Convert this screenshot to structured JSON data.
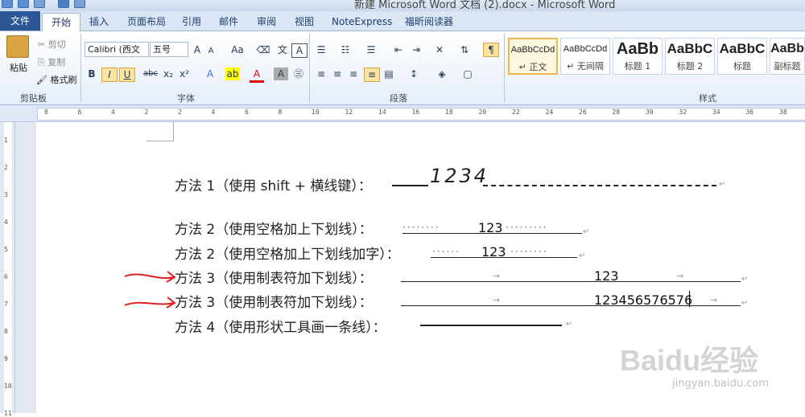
{
  "window": {
    "title": "新建 Microsoft Word 文档 (2).docx - Microsoft Word"
  },
  "tabs": [
    "文件",
    "开始",
    "插入",
    "页面布局",
    "引用",
    "邮件",
    "审阅",
    "视图",
    "NoteExpress",
    "福昕阅读器"
  ],
  "clipboard": {
    "paste": "粘贴",
    "cut": "剪切",
    "copy": "复制",
    "format_painter": "格式刷",
    "group": "剪贴板"
  },
  "font": {
    "name": "Calibri (西文",
    "size": "五号",
    "group": "字体"
  },
  "paragraph": {
    "group": "段落"
  },
  "styles": {
    "group": "样式",
    "items": [
      {
        "preview": "AaBbCcDd",
        "name": "↵ 正文"
      },
      {
        "preview": "AaBbCcDd",
        "name": "↵ 无间隔"
      },
      {
        "preview": "AaBb",
        "name": "标题 1"
      },
      {
        "preview": "AaBbC",
        "name": "标题 2"
      },
      {
        "preview": "AaBbC",
        "name": "标题"
      },
      {
        "preview": "AaBb",
        "name": "副标题"
      }
    ]
  },
  "ruler": {
    "h_numbers": [
      "8",
      "6",
      "4",
      "2",
      "2",
      "4",
      "6",
      "8",
      "10",
      "12",
      "14",
      "16",
      "18",
      "20",
      "22",
      "24",
      "26",
      "28",
      "30",
      "32",
      "34",
      "36",
      "38"
    ],
    "v_numbers": [
      "1",
      "2",
      "3",
      "4",
      "5",
      "6",
      "7",
      "8",
      "9",
      "10",
      "11"
    ]
  },
  "document": {
    "lines": [
      {
        "text": "方法 1（使用 shift + 横线键）：",
        "handwriting": "1234"
      },
      {
        "text": "方法 2（使用空格加上下划线）：",
        "value": "123"
      },
      {
        "text": "方法 2（使用空格加上下划线加字）：",
        "value": "123"
      },
      {
        "text": "方法 3（使用制表符加下划线）：",
        "value": "123"
      },
      {
        "text": "方法 3（使用制表符加下划线）：",
        "value": "123456576576"
      },
      {
        "text": "方法 4（使用形状工具画一条线）：",
        "value": ""
      }
    ]
  },
  "watermark": {
    "brand": "Baidu经验",
    "url": "jingyan.baidu.com"
  },
  "colors": {
    "file_tab": "#2b5797",
    "annotation_arrow": "#e02020",
    "ribbon_bg": "#e6eef9"
  }
}
